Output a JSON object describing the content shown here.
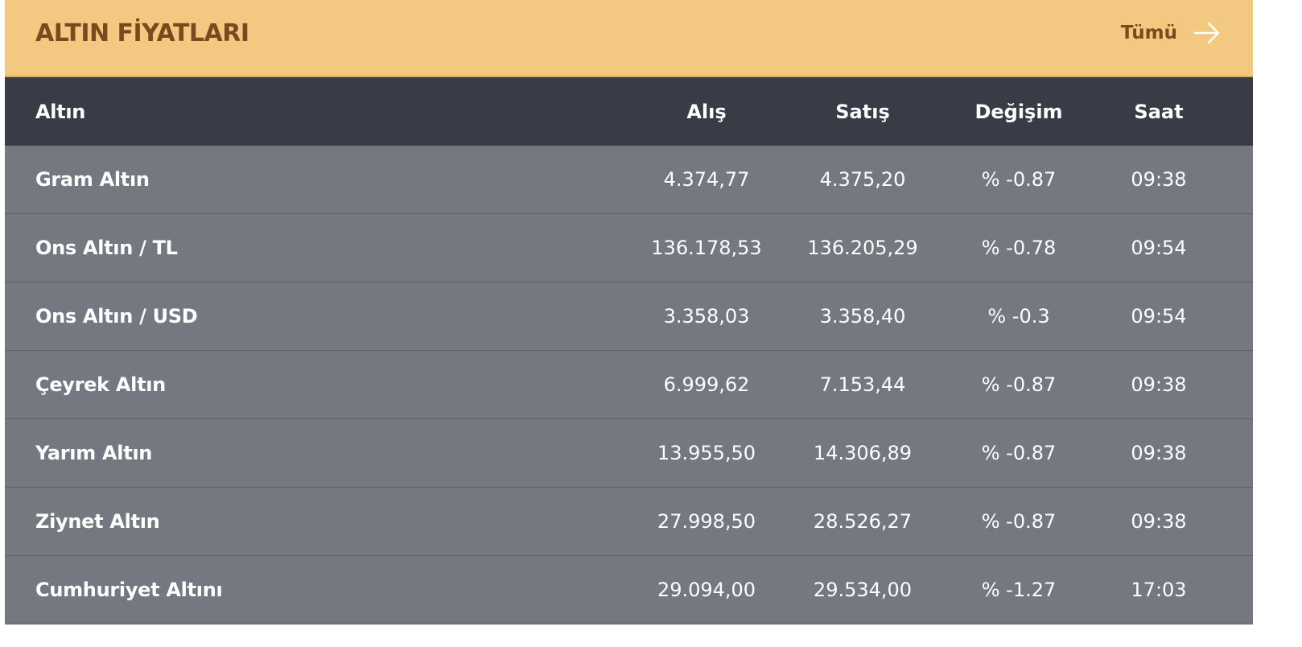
{
  "header": {
    "title": "ALTIN FİYATLARI",
    "all_label": "Tümü"
  },
  "columns": {
    "name": "Altın",
    "buy": "Alış",
    "sell": "Satış",
    "change": "Değişim",
    "time": "Saat"
  },
  "rows": [
    {
      "name": "Gram Altın",
      "buy": "4.374,77",
      "sell": "4.375,20",
      "change": "% -0.87",
      "time": "09:38"
    },
    {
      "name": "Ons Altın / TL",
      "buy": "136.178,53",
      "sell": "136.205,29",
      "change": "% -0.78",
      "time": "09:54"
    },
    {
      "name": "Ons Altın / USD",
      "buy": "3.358,03",
      "sell": "3.358,40",
      "change": "% -0.3",
      "time": "09:54"
    },
    {
      "name": "Çeyrek Altın",
      "buy": "6.999,62",
      "sell": "7.153,44",
      "change": "% -0.87",
      "time": "09:38"
    },
    {
      "name": "Yarım Altın",
      "buy": "13.955,50",
      "sell": "14.306,89",
      "change": "% -0.87",
      "time": "09:38"
    },
    {
      "name": "Ziynet Altın",
      "buy": "27.998,50",
      "sell": "28.526,27",
      "change": "% -0.87",
      "time": "09:38"
    },
    {
      "name": "Cumhuriyet Altını",
      "buy": "29.094,00",
      "sell": "29.534,00",
      "change": "% -1.27",
      "time": "17:03"
    }
  ],
  "colors": {
    "header_bg": "#f3c981",
    "title_text": "#7a4a1e",
    "table_head_bg": "#383c46",
    "row_bg": "#737881"
  },
  "icons": {
    "all_link": "arrow-right-icon"
  }
}
